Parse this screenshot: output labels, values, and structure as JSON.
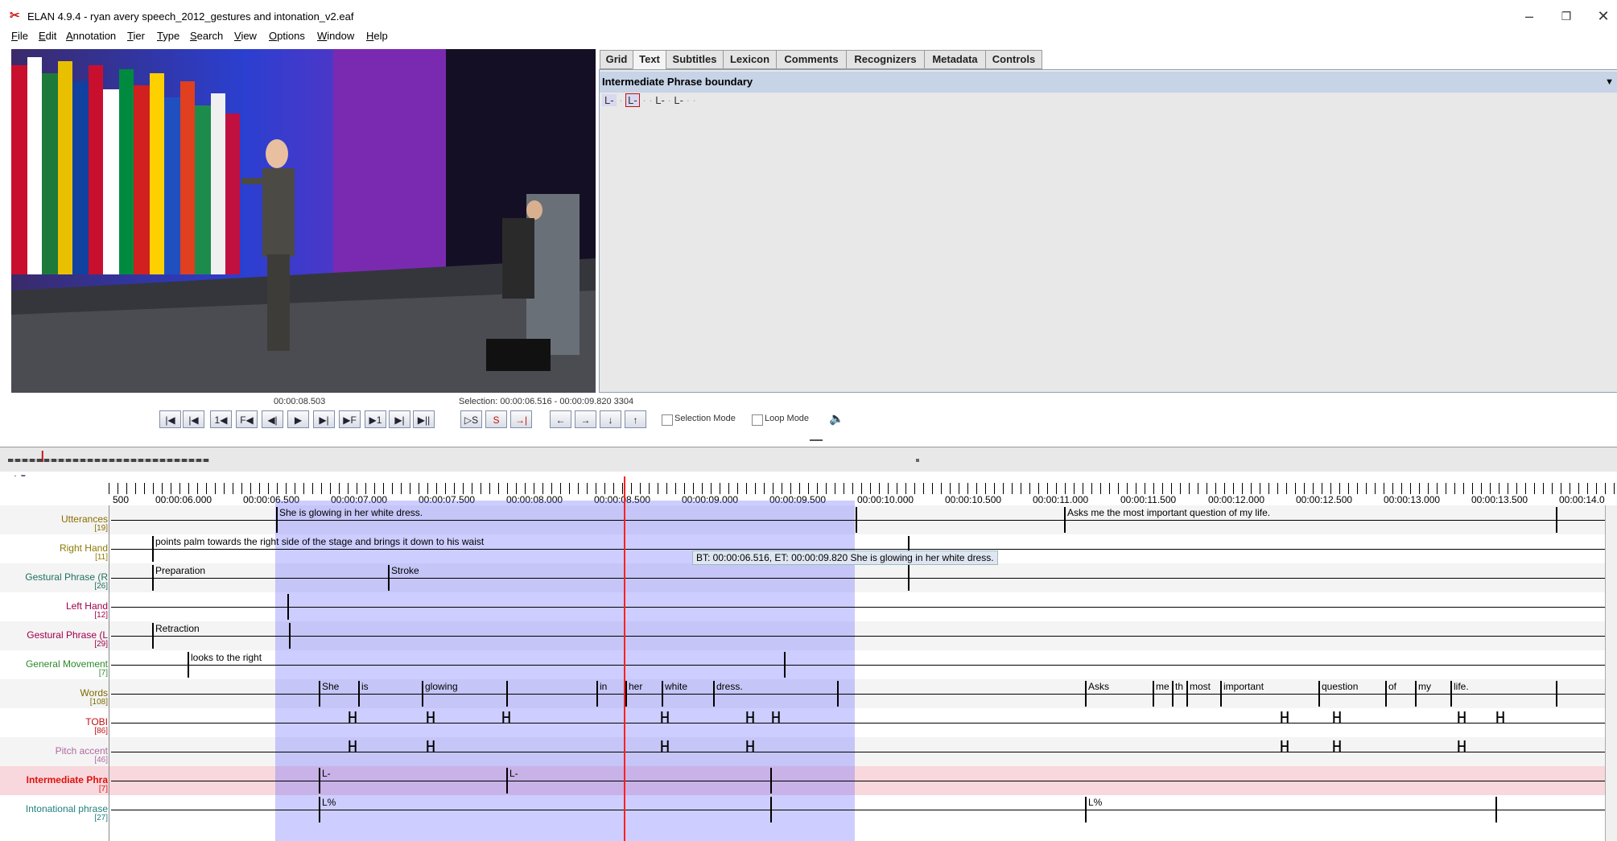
{
  "window": {
    "title": "ELAN 4.9.4 - ryan avery speech_2012_gestures and intonation_v2.eaf",
    "minimize": "–",
    "restore": "❐",
    "close": "✕"
  },
  "menu": [
    "File",
    "Edit",
    "Annotation",
    "Tier",
    "Type",
    "Search",
    "View",
    "Options",
    "Window",
    "Help"
  ],
  "tabs": [
    "Grid",
    "Text",
    "Subtitles",
    "Lexicon",
    "Comments",
    "Recognizers",
    "Metadata",
    "Controls"
  ],
  "selected_tab": "Text",
  "text_panel": {
    "tier_name": "Intermediate Phrase boundary",
    "content": [
      "L-",
      "L-",
      "L-",
      "L-"
    ]
  },
  "media": {
    "current_time": "00:00:08.503",
    "selection": "Selection: 00:00:06.516 - 00:00:09.820  3304",
    "selection_mode_label": "Selection Mode",
    "loop_mode_label": "Loop Mode"
  },
  "control_icons": [
    "|◀",
    "|◀",
    "1◀",
    "F◀",
    "◀|",
    "▶",
    "▶|",
    "▶F",
    "▶1",
    "▶|",
    "▶||"
  ],
  "selection_icons": [
    "▷S",
    "S",
    "→|"
  ],
  "nav_icons": [
    "←",
    "→",
    "↓",
    "↑"
  ],
  "ruler": {
    "labels": [
      "500",
      "00:00:06.000",
      "00:00:06.500",
      "00:00:07.000",
      "00:00:07.500",
      "00:00:08.000",
      "00:00:08.500",
      "00:00:09.000",
      "00:00:09.500",
      "00:00:10.000",
      "00:00:10.500",
      "00:00:11.000",
      "00:00:11.500",
      "00:00:12.000",
      "00:00:12.500",
      "00:00:13.000",
      "00:00:13.500",
      "00:00:14.0"
    ]
  },
  "tiers": [
    {
      "name": "Utterances",
      "count": "[19]",
      "color": "#8a6d00"
    },
    {
      "name": "Right Hand",
      "count": "[11]",
      "color": "#8a7a00"
    },
    {
      "name": "Gestural Phrase (R",
      "count": "[26]",
      "color": "#1f6f5f"
    },
    {
      "name": "Left Hand",
      "count": "[12]",
      "color": "#a0004a"
    },
    {
      "name": "Gestural Phrase (L",
      "count": "[29]",
      "color": "#a0004a"
    },
    {
      "name": "General Movement",
      "count": "[7]",
      "color": "#2a8a2a"
    },
    {
      "name": "Words",
      "count": "[108]",
      "color": "#7a6a00"
    },
    {
      "name": "TOBI",
      "count": "[86]",
      "color": "#c01010"
    },
    {
      "name": "Pitch accent",
      "count": "[46]",
      "color": "#b06aa0"
    },
    {
      "name": "Intermediate Phra",
      "count": "[7]",
      "color": "#e01010"
    },
    {
      "name": "Intonational phrase",
      "count": "[27]",
      "color": "#1f7f7f"
    }
  ],
  "annotations": {
    "utterance1": "She is glowing in her white dress.",
    "utterance2": "Asks me the most important question of my life.",
    "right_hand": "points palm towards the right side of the stage and brings it down to his waist",
    "tooltip": "BT: 00:00:06.516, ET: 00:00:09.820 She is glowing in her white dress.",
    "gp_r1": "Preparation",
    "gp_r2": "Stroke",
    "gp_l1": "Retraction",
    "movement": "looks to the right",
    "words": [
      "She",
      "is",
      "glowing",
      "in",
      "her",
      "white",
      "dress.",
      "Asks",
      "me",
      "th",
      "most",
      "important",
      "question",
      "of",
      "my",
      "life."
    ],
    "ip1": "L-",
    "ip2": "L-",
    "intonational1": "L%",
    "intonational2": "L%"
  }
}
